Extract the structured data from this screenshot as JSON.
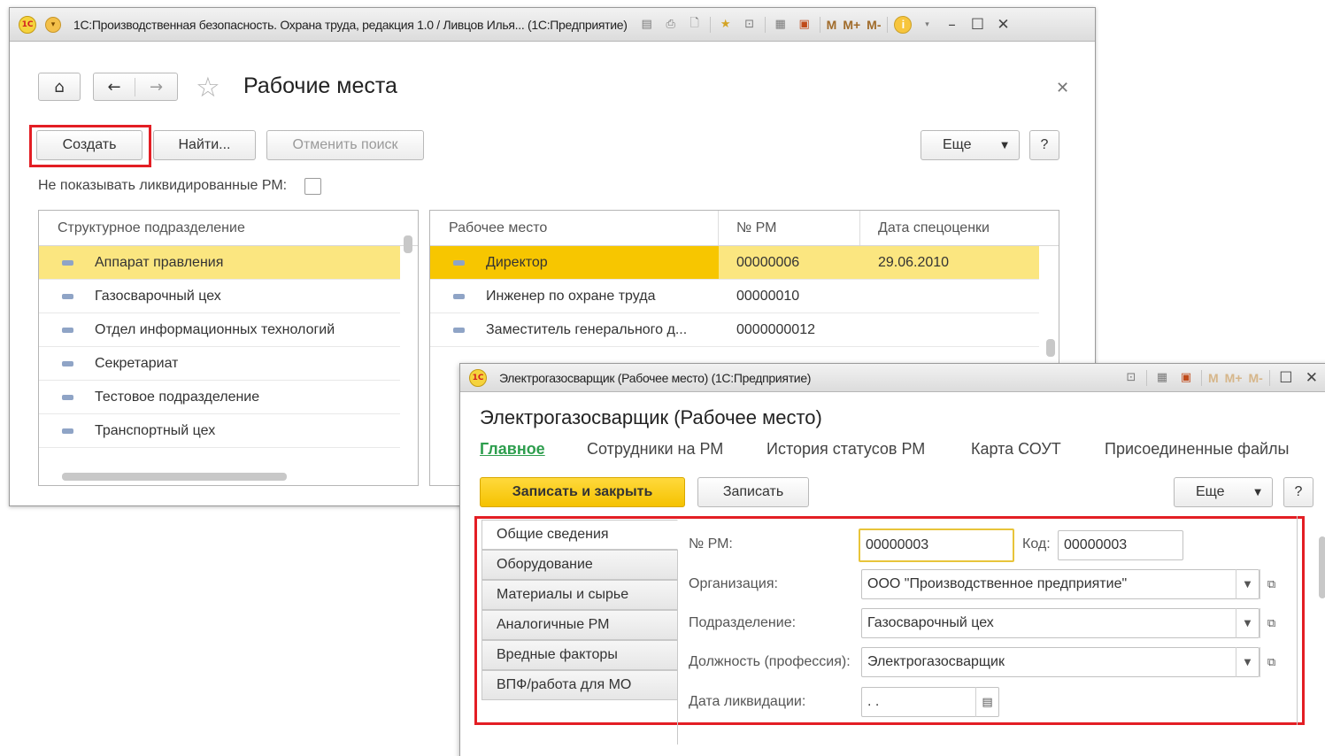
{
  "main_window": {
    "title": "1С:Производственная безопасность. Охрана труда, редакция 1.0 / Ливцов Илья...  (1С:Предприятие)",
    "tb_m": "M",
    "tb_mplus": "M+",
    "tb_mminus": "M-",
    "form_title": "Рабочие места",
    "buttons": {
      "create": "Создать",
      "find": "Найти...",
      "cancel_search": "Отменить поиск",
      "more": "Еще",
      "help": "?"
    },
    "hide_liquidated_label": "Не показывать ликвидированные РМ:",
    "departments": {
      "header": "Структурное подразделение",
      "items": [
        "Аппарат правления",
        "Газосварочный цех",
        "Отдел информационных технологий",
        "Секретариат",
        "Тестовое подразделение",
        "Транспортный цех"
      ]
    },
    "workplaces": {
      "columns": [
        "Рабочее место",
        "№ РМ",
        "Дата спецоценки"
      ],
      "rows": [
        {
          "name": "Директор",
          "num": "00000006",
          "date": "29.06.2010"
        },
        {
          "name": "Инженер по охране труда",
          "num": "00000010",
          "date": ""
        },
        {
          "name": "Заместитель генерального д...",
          "num": "0000000012",
          "date": ""
        }
      ]
    }
  },
  "form_window": {
    "title": "Электрогазосварщик (Рабочее место)  (1С:Предприятие)",
    "tb_m": "M",
    "tb_mplus": "M+",
    "tb_mminus": "M-",
    "heading": "Электрогазосварщик (Рабочее место)",
    "tabs": [
      "Главное",
      "Сотрудники на РМ",
      "История статусов РМ",
      "Карта СОУТ",
      "Присоединенные файлы"
    ],
    "buttons": {
      "save_close": "Записать и закрыть",
      "save": "Записать",
      "more": "Еще",
      "help": "?"
    },
    "side_tabs": [
      "Общие сведения",
      "Оборудование",
      "Материалы и сырье",
      "Аналогичные РМ",
      "Вредные факторы",
      "ВПФ/работа для МО"
    ],
    "fields": {
      "num_label": "№ РМ:",
      "num_value": "00000003",
      "code_label": "Код:",
      "code_value": "00000003",
      "org_label": "Организация:",
      "org_value": "ООО \"Производственное предприятие\"",
      "dept_label": "Подразделение:",
      "dept_value": "Газосварочный цех",
      "position_label": "Должность (профессия):",
      "position_value": "Электрогазосварщик",
      "liq_label": "Дата ликвидации:",
      "liq_value": " .  ."
    }
  },
  "colors": {
    "highlight": "#fbe680",
    "accent_yellow": "#f5c200",
    "frame_red": "#e31e24",
    "tab_green": "#2e9e4e"
  }
}
